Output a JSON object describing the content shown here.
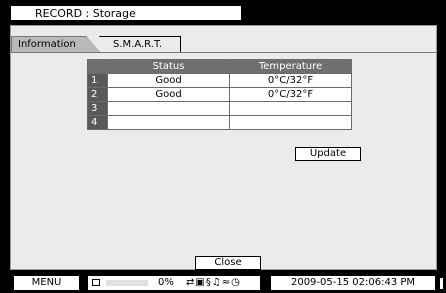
{
  "window": {
    "title": "RECORD : Storage"
  },
  "tabs": [
    {
      "label": "Information",
      "active": false
    },
    {
      "label": "S.M.A.R.T.",
      "active": true
    }
  ],
  "smart_table": {
    "headers": [
      "Status",
      "Temperature"
    ],
    "rows": [
      {
        "index": "1",
        "status": "Good",
        "temperature": "0°C/32°F"
      },
      {
        "index": "2",
        "status": "Good",
        "temperature": "0°C/32°F"
      },
      {
        "index": "3",
        "status": "",
        "temperature": ""
      },
      {
        "index": "4",
        "status": "",
        "temperature": ""
      }
    ]
  },
  "buttons": {
    "update": "Update",
    "close": "Close"
  },
  "statusbar": {
    "menu": "MENU",
    "hdd_usage_percent": "0%",
    "hdd_usage_fraction": 0,
    "icons": [
      "network-icon",
      "camera-icon",
      "alarm-icon",
      "audio-icon",
      "motion-icon",
      "clock-icon"
    ],
    "icon_glyphs": "⇄▣§♫≈◷",
    "datetime": "2009-05-15  02:06:43 PM"
  },
  "colors": {
    "background": "#000000",
    "panel": "#ecebea",
    "header": "#6f6f6f",
    "index_cell": "#595959"
  }
}
